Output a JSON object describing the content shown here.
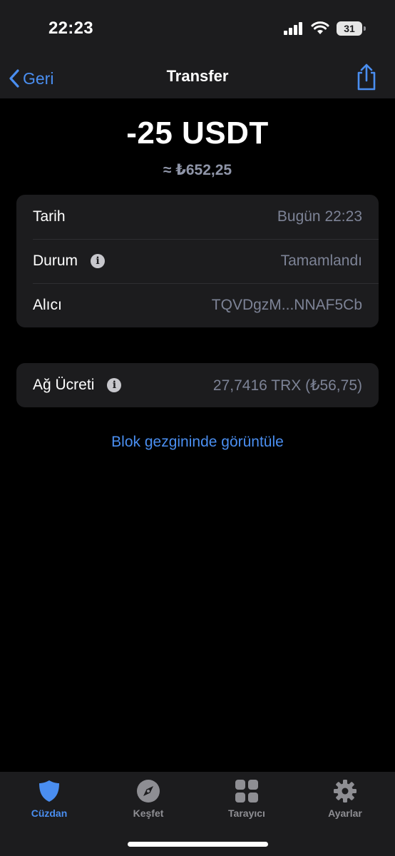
{
  "status_bar": {
    "time": "22:23",
    "battery": "31"
  },
  "nav": {
    "back_label": "Geri",
    "title": "Transfer"
  },
  "transaction": {
    "amount": "-25 USDT",
    "fiat_amount": "≈ ₺652,25",
    "details": {
      "date_label": "Tarih",
      "date_value": "Bugün 22:23",
      "status_label": "Durum",
      "status_value": "Tamamlandı",
      "recipient_label": "Alıcı",
      "recipient_value": "TQVDgzM...NNAF5Cb"
    },
    "fee": {
      "label": "Ağ Ücreti",
      "value": "27,7416 TRX (₺56,75)"
    },
    "explorer_link": "Blok gezgininde görüntüle"
  },
  "tabs": [
    {
      "label": "Cüzdan",
      "icon": "shield-icon",
      "active": true
    },
    {
      "label": "Keşfet",
      "icon": "compass-icon",
      "active": false
    },
    {
      "label": "Tarayıcı",
      "icon": "grid-icon",
      "active": false
    },
    {
      "label": "Ayarlar",
      "icon": "gear-icon",
      "active": false
    }
  ],
  "colors": {
    "accent": "#4a8ef0",
    "background": "#000000",
    "surface": "#1c1c1e",
    "secondary_text": "#7d8396"
  }
}
